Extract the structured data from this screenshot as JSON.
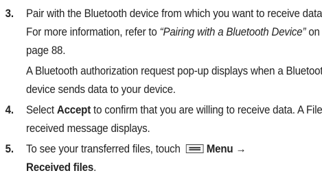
{
  "steps": [
    {
      "number": "3.",
      "text_pre": "Pair with the Bluetooth device from which you want to receive data. For more information, refer to ",
      "xref": "“Pairing with a Bluetooth Device”",
      "text_post": "  on page 88.",
      "sub_text": "A Bluetooth authorization request pop-up displays when a Bluetooth device sends data to your device."
    },
    {
      "number": "4.",
      "text_pre": "Select ",
      "bold": "Accept",
      "text_post": " to confirm that you are willing to receive data. A File received message displays."
    },
    {
      "number": "5.",
      "text_pre": "To see your transferred files, touch ",
      "icon": "menu-icon",
      "bold_1": "Menu →",
      "bold_2": "Received files",
      "text_post": "."
    }
  ]
}
